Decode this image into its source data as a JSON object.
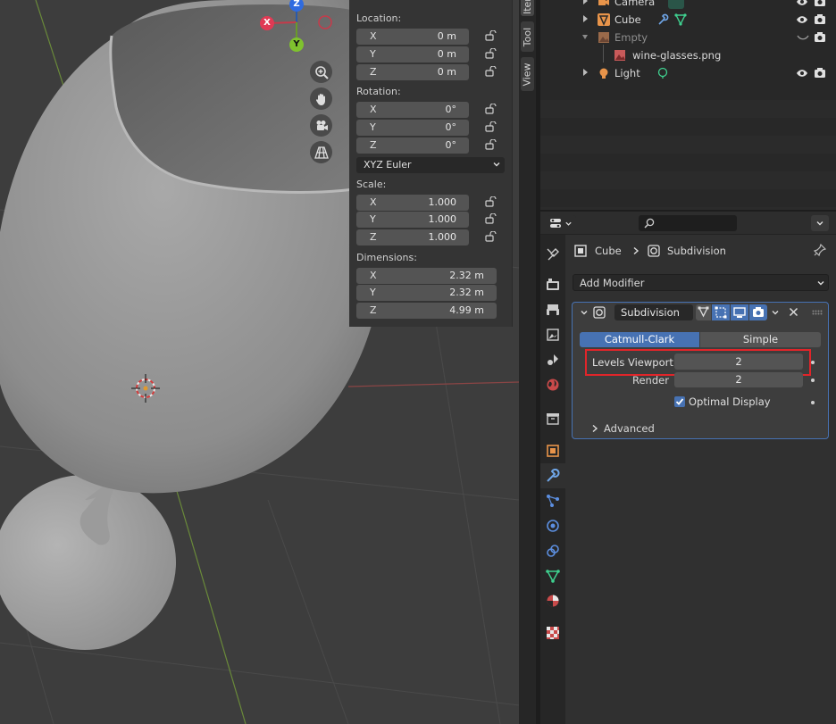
{
  "viewport": {
    "gizmo": {
      "z": "Z",
      "x": "X",
      "y": "Y"
    },
    "tools": [
      "zoom-icon",
      "hand-icon",
      "camera-icon",
      "perspective-grid-icon"
    ]
  },
  "npanel": {
    "location_label": "Location:",
    "location": [
      {
        "axis": "X",
        "value": "0 m"
      },
      {
        "axis": "Y",
        "value": "0 m"
      },
      {
        "axis": "Z",
        "value": "0 m"
      }
    ],
    "rotation_label": "Rotation:",
    "rotation": [
      {
        "axis": "X",
        "value": "0°"
      },
      {
        "axis": "Y",
        "value": "0°"
      },
      {
        "axis": "Z",
        "value": "0°"
      }
    ],
    "rotation_mode": "XYZ Euler",
    "scale_label": "Scale:",
    "scale": [
      {
        "axis": "X",
        "value": "1.000"
      },
      {
        "axis": "Y",
        "value": "1.000"
      },
      {
        "axis": "Z",
        "value": "1.000"
      }
    ],
    "dimensions_label": "Dimensions:",
    "dimensions": [
      {
        "axis": "X",
        "value": "2.32 m"
      },
      {
        "axis": "Y",
        "value": "2.32 m"
      },
      {
        "axis": "Z",
        "value": "4.99 m"
      }
    ]
  },
  "tabs": {
    "item": "Item",
    "tool": "Tool",
    "view": "View"
  },
  "outliner": {
    "rows": [
      {
        "label": "Camera"
      },
      {
        "label": "Cube"
      },
      {
        "label": "Empty"
      },
      {
        "label": "wine-glasses.png"
      },
      {
        "label": "Light"
      }
    ]
  },
  "properties": {
    "breadcrumb": {
      "object": "Cube",
      "modifier": "Subdivision"
    },
    "add_modifier": "Add Modifier",
    "modifier": {
      "name": "Subdivision",
      "type_tabs": [
        "Catmull-Clark",
        "Simple"
      ],
      "levels_viewport_label": "Levels Viewport",
      "levels_viewport": "2",
      "render_label": "Render",
      "render": "2",
      "optimal_display": "Optimal Display",
      "advanced": "Advanced"
    }
  },
  "colors": {
    "accent": "#4772b3",
    "highlight_box": "#e0252a"
  }
}
